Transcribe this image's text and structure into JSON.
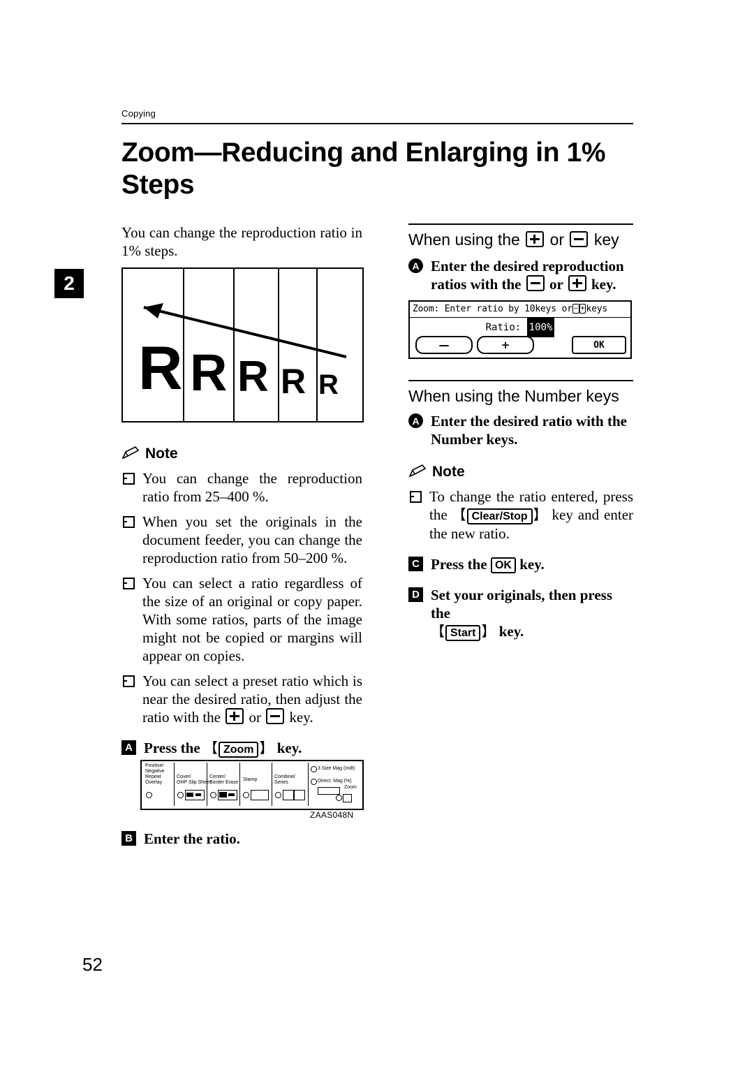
{
  "header": {
    "section_label": "Copying",
    "chapter_tab": "2",
    "title": "Zoom—Reducing and Enlarging in 1% Steps"
  },
  "left": {
    "intro": "You can change the reproduction ratio in 1% steps.",
    "note_label": "Note",
    "notes": [
      "You can change the reproduction ratio from 25–400 %.",
      "When you set the originals in the document feeder, you can change the reproduction ratio from 50–200 %.",
      "You can select a ratio regardless of the size of an original or copy paper. With some ratios, parts of the image might not be copied or margins will appear on copies.",
      "You can select a preset ratio which is near the desired ratio, then adjust the ratio with the"
    ],
    "note4_mid": "or",
    "note4_tail": "key.",
    "step1_num": "A",
    "step1_pre": "Press the",
    "step1_key": "Zoom",
    "step1_post": "key.",
    "step2_num": "B",
    "step2_text": "Enter the ratio.",
    "figure_code": "ZAAS048N",
    "figure_r": {
      "letters": [
        "R",
        "R",
        "R",
        "R",
        "R"
      ]
    },
    "panel": {
      "labels": [
        "Positive/",
        "Negative",
        "Repeat",
        "Overlay",
        "Cover/",
        "OHP Slip Sheet",
        "Center/",
        "Border Erase",
        "Stamp",
        "Combine/",
        "Series",
        "3 Size Mag (Indt)",
        "Direct. Mag (%)",
        "Zoom"
      ]
    }
  },
  "right": {
    "sec1_head_pre": "When using the",
    "sec1_head_mid": "or",
    "sec1_head_post": "key",
    "step1_num": "A",
    "step1_line1": "Enter the desired reproduction",
    "step1_line2_pre": "ratios with the",
    "step1_line2_mid": "or",
    "step1_line2_post": "key.",
    "lcd": {
      "top_pre": "Zoom: Enter ratio by 10keys or",
      "top_minus": "–",
      "top_plus": "+",
      "top_post": "keys",
      "ratio_label": "Ratio:",
      "ratio_value": "100%",
      "btn_minus": "—",
      "btn_plus": "+",
      "btn_ok": "OK"
    },
    "sec2_head": "When using the Number keys",
    "sec2_step_num": "A",
    "sec2_step_line1": "Enter the desired ratio with the",
    "sec2_step_line2": "Number keys.",
    "note_label": "Note",
    "note_pre": "To change the ratio entered, press the",
    "note_key": "Clear/Stop",
    "note_post": "key and enter the new ratio.",
    "step3_num": "C",
    "step3_pre": "Press the",
    "step3_key": "OK",
    "step3_post": "key.",
    "step4_num": "D",
    "step4_line1": "Set your originals, then press the",
    "step4_key": "Start",
    "step4_post": "key."
  },
  "footer": {
    "page_number": "52"
  }
}
